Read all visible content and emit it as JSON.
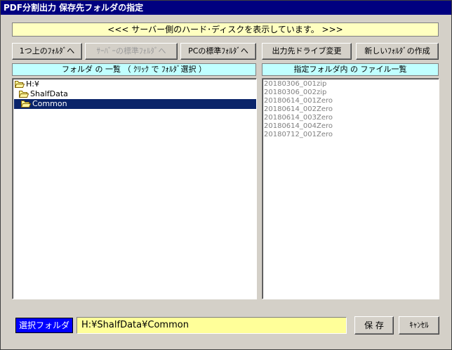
{
  "window": {
    "title": "PDF分割出力  保存先フォルダの指定"
  },
  "banner": {
    "text": "<<<  サーバー側のハード･ディスクを表示しています。 >>>"
  },
  "toolbar": {
    "up_label": "1つ上のﾌｫﾙﾀﾞへ",
    "server_default_label": "ｻｰﾊﾞｰの標準ﾌｫﾙﾀﾞへ",
    "pc_default_label": "PCの標準ﾌｫﾙﾀﾞへ",
    "change_drive_label": "出力先ドライブ変更",
    "new_folder_label": "新しいﾌｫﾙﾀﾞの作成"
  },
  "folder_panel": {
    "header": "フォルダ の 一覧  （ ｸﾘｯｸ で ﾌｫﾙﾀﾞ選択 ）",
    "items": [
      {
        "label": "H:¥",
        "level": 0
      },
      {
        "label": "ShalfData",
        "level": 1
      },
      {
        "label": "Common",
        "level": 2,
        "selected": true
      }
    ]
  },
  "file_panel": {
    "header": "指定フォルダ内 の ファイル一覧",
    "files": [
      "20180306_001zip",
      "20180306_002zip",
      "20180614_001Zero",
      "20180614_002Zero",
      "20180614_003Zero",
      "20180614_004Zero",
      "20180712_001Zero"
    ]
  },
  "footer": {
    "selected_label": "選択フォルダ",
    "selected_path": "H:¥ShalfData¥Common",
    "save_label": "保 存",
    "cancel_label": "ｷｬﾝｾﾙ"
  },
  "colors": {
    "title_bar": "#000080",
    "banner_bg": "#ffffc0",
    "header_bg": "#c0ffff",
    "selection": "#0a246a",
    "path_bg": "#ffff99",
    "selected_label_bg": "#0000ff"
  },
  "icons": {
    "folder": "folder-icon",
    "open_folder": "folder-open-icon"
  }
}
